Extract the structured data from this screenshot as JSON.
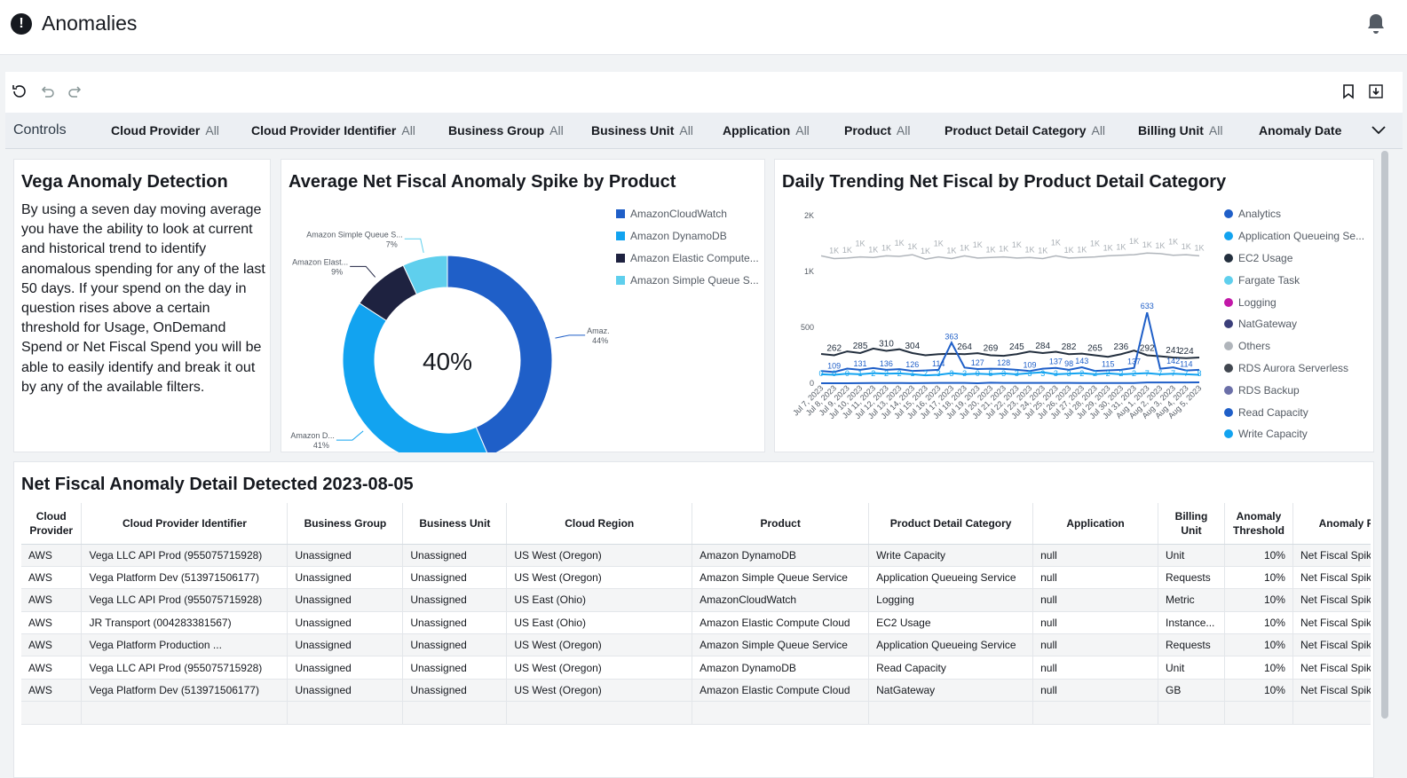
{
  "page": {
    "title": "Anomalies"
  },
  "controls": {
    "label": "Controls",
    "items": [
      {
        "name": "Cloud Provider",
        "value": "All"
      },
      {
        "name": "Cloud Provider Identifier",
        "value": "All"
      },
      {
        "name": "Business Group",
        "value": "All"
      },
      {
        "name": "Business Unit",
        "value": "All"
      },
      {
        "name": "Application",
        "value": "All"
      },
      {
        "name": "Product",
        "value": "All"
      },
      {
        "name": "Product Detail Category",
        "value": "All"
      },
      {
        "name": "Billing Unit",
        "value": "All"
      },
      {
        "name": "Anomaly Date",
        "value": ""
      }
    ]
  },
  "intro": {
    "title": "Vega Anomaly Detection",
    "text": "By using a seven day moving average you have the ability to look at current and historical trend to identify anomalous spending for any of the last 50 days. If your spend on the day in question rises above a certain threshold for Usage, OnDemand Spend or Net Fiscal Spend you will be able to easily identify and break it out by any of the available filters."
  },
  "donut": {
    "title": "Average Net Fiscal Anomaly Spike by Product",
    "center_label": "40%",
    "slice_labels": [
      {
        "name": "Amaz...",
        "pct": "44%"
      },
      {
        "name": "Amazon D...",
        "pct": "41%"
      },
      {
        "name": "Amazon Elast...",
        "pct": "9%"
      },
      {
        "name": "Amazon Simple Queue S...",
        "pct": "7%"
      }
    ],
    "legend": [
      "AmazonCloudWatch",
      "Amazon DynamoDB",
      "Amazon Elastic Compute...",
      "Amazon Simple Queue S..."
    ]
  },
  "trend": {
    "title": "Daily Trending Net Fiscal by Product Detail Category",
    "legend": [
      "Analytics",
      "Application Queueing Se...",
      "EC2 Usage",
      "Fargate Task",
      "Logging",
      "NatGateway",
      "Others",
      "RDS Aurora Serverless",
      "RDS Backup",
      "Read Capacity",
      "Write Capacity"
    ]
  },
  "chart_data": [
    {
      "type": "pie",
      "title": "Average Net Fiscal Anomaly Spike by Product",
      "categories": [
        "AmazonCloudWatch",
        "Amazon DynamoDB",
        "Amazon Elastic Compute...",
        "Amazon Simple Queue S..."
      ],
      "values": [
        44,
        41,
        9,
        7
      ],
      "center_label": "40%",
      "colors": [
        "#1f5fc8",
        "#12a3f0",
        "#1e2240",
        "#5fcfed"
      ],
      "legend": "right"
    },
    {
      "type": "line",
      "title": "Daily Trending Net Fiscal by Product Detail Category",
      "x": [
        "Jul 7, 2023",
        "Jul 8, 2023",
        "Jul 9, 2023",
        "Jul 10, 2023",
        "Jul 11, 2023",
        "Jul 12, 2023",
        "Jul 13, 2023",
        "Jul 14, 2023",
        "Jul 15, 2023",
        "Jul 16, 2023",
        "Jul 17, 2023",
        "Jul 18, 2023",
        "Jul 19, 2023",
        "Jul 20, 2023",
        "Jul 21, 2023",
        "Jul 22, 2023",
        "Jul 23, 2023",
        "Jul 24, 2023",
        "Jul 25, 2023",
        "Jul 26, 2023",
        "Jul 27, 2023",
        "Jul 28, 2023",
        "Jul 29, 2023",
        "Jul 30, 2023",
        "Jul 31, 2023",
        "Aug 1, 2023",
        "Aug 2, 2023",
        "Aug 3, 2023",
        "Aug 4, 2023",
        "Aug 5, 2023"
      ],
      "yticks": [
        "0",
        "500",
        "1K",
        "2K"
      ],
      "series": [
        {
          "name": "Others",
          "color": "#b0b5bb",
          "label": "1K",
          "values": [
            1280,
            1230,
            1240,
            1260,
            1250,
            1280,
            1270,
            1300,
            1220,
            1260,
            1230,
            1280,
            1240,
            1250,
            1260,
            1240,
            1250,
            1230,
            1280,
            1240,
            1250,
            1260,
            1280,
            1290,
            1300,
            1330,
            1320,
            1290,
            1300,
            1280
          ]
        },
        {
          "name": "EC2 Usage",
          "color": "#232f3e",
          "labels": [
            "262",
            "285",
            "310",
            "304",
            "",
            "264",
            "269",
            "245",
            "284",
            "282",
            "265",
            "236",
            "292",
            "241",
            "224"
          ],
          "values": [
            262,
            250,
            285,
            270,
            310,
            290,
            304,
            270,
            250,
            260,
            264,
            260,
            269,
            250,
            245,
            260,
            284,
            270,
            282,
            260,
            265,
            250,
            236,
            260,
            292,
            250,
            241,
            230,
            224,
            230
          ]
        },
        {
          "name": "Read Capacity",
          "color": "#1f5fc8",
          "values": [
            109,
            100,
            131,
            120,
            136,
            120,
            126,
            110,
            114,
            120,
            363,
            140,
            127,
            130,
            128,
            120,
            109,
            130,
            137,
            120,
            143,
            110,
            115,
            120,
            137,
            633,
            130,
            142,
            114,
            120
          ]
        },
        {
          "name": "Write Capacity",
          "color": "#12a3f0",
          "values": [
            80,
            75,
            85,
            80,
            90,
            85,
            88,
            80,
            70,
            75,
            90,
            80,
            85,
            80,
            88,
            80,
            90,
            98,
            80,
            85,
            90,
            80,
            88,
            80,
            85,
            90,
            80,
            85,
            80,
            75
          ]
        },
        {
          "name": "Analytics",
          "color": "#1f5fc8",
          "values": [
            0,
            0,
            0,
            1,
            2,
            2,
            2,
            1,
            2,
            3,
            3,
            3,
            0,
            5,
            3,
            3,
            3,
            3,
            3,
            3,
            2,
            2,
            2,
            2,
            2,
            7,
            7,
            7,
            7,
            8
          ]
        }
      ],
      "legend": "right"
    }
  ],
  "table": {
    "title": "Net Fiscal Anomaly Detail Detected 2023-08-05",
    "columns": [
      "Cloud Provider",
      "Cloud Provider Identifier",
      "Business Group",
      "Business Unit",
      "Cloud Region",
      "Product",
      "Product Detail Category",
      "Application",
      "Billing Unit",
      "Anomaly Threshold",
      "Anomaly Flag"
    ],
    "rows": [
      [
        "AWS",
        "Vega LLC API Prod (955075715928)",
        "Unassigned",
        "Unassigned",
        "US West (Oregon)",
        "Amazon DynamoDB",
        "Write Capacity",
        "null",
        "Unit",
        "10%",
        "Net Fiscal Spike"
      ],
      [
        "AWS",
        "Vega Platform Dev (513971506177)",
        "Unassigned",
        "Unassigned",
        "US West (Oregon)",
        "Amazon Simple Queue Service",
        "Application Queueing Service",
        "null",
        "Requests",
        "10%",
        "Net Fiscal Spike"
      ],
      [
        "AWS",
        "Vega LLC API Prod (955075715928)",
        "Unassigned",
        "Unassigned",
        "US East (Ohio)",
        "AmazonCloudWatch",
        "Logging",
        "null",
        "Metric",
        "10%",
        "Net Fiscal Spike"
      ],
      [
        "AWS",
        "JR Transport (004283381567)",
        "Unassigned",
        "Unassigned",
        "US East (Ohio)",
        "Amazon Elastic Compute Cloud",
        "EC2 Usage",
        "null",
        "Instance...",
        "10%",
        "Net Fiscal Spike"
      ],
      [
        "AWS",
        "Vega Platform Production ...",
        "Unassigned",
        "Unassigned",
        "US West (Oregon)",
        "Amazon Simple Queue Service",
        "Application Queueing Service",
        "null",
        "Requests",
        "10%",
        "Net Fiscal Spike"
      ],
      [
        "AWS",
        "Vega LLC API Prod (955075715928)",
        "Unassigned",
        "Unassigned",
        "US West (Oregon)",
        "Amazon DynamoDB",
        "Read Capacity",
        "null",
        "Unit",
        "10%",
        "Net Fiscal Spike"
      ],
      [
        "AWS",
        "Vega Platform Dev (513971506177)",
        "Unassigned",
        "Unassigned",
        "US West (Oregon)",
        "Amazon Elastic Compute Cloud",
        "NatGateway",
        "null",
        "GB",
        "10%",
        "Net Fiscal Spike"
      ]
    ]
  },
  "colors": {
    "legend": [
      "#1f5fc8",
      "#12a3f0",
      "#232f3e",
      "#5fcfed",
      "#c218a8",
      "#3b3f7a",
      "#b0b5bb",
      "#414750",
      "#6b6fa8",
      "#1f5fc8",
      "#12a3f0"
    ]
  },
  "icons": {
    "alert": "exclamation-icon",
    "bell": "bell-icon",
    "refresh": "refresh-icon",
    "undo": "undo-icon",
    "redo": "redo-icon",
    "bookmark": "bookmark-icon",
    "download": "download-icon",
    "expand": "chevron-down-icon"
  }
}
